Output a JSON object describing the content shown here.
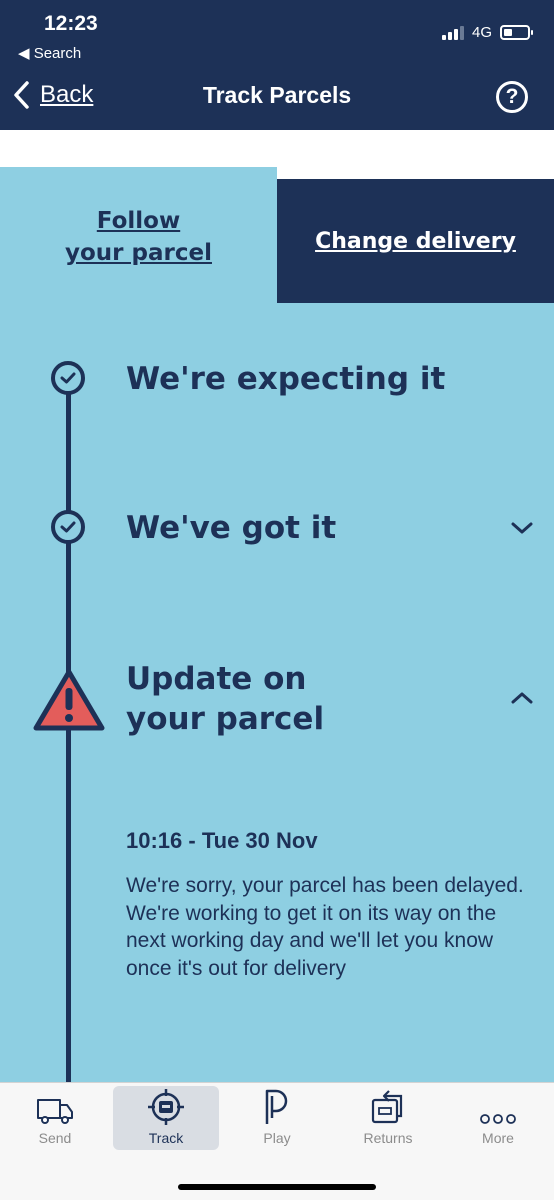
{
  "status_bar": {
    "time": "12:23",
    "back_app": "◀ Search",
    "network": "4G",
    "battery_level": 0.35
  },
  "header": {
    "back_label": "Back",
    "title": "Track Parcels",
    "help_icon": "question-circle-icon"
  },
  "tabs": {
    "follow_line1": "Follow",
    "follow_line2": "your parcel",
    "change": "Change delivery",
    "active": "follow"
  },
  "timeline": {
    "steps": [
      {
        "title": "We're expecting it",
        "status": "complete",
        "icon": "check-circle-icon"
      },
      {
        "title": "We've got it",
        "status": "complete",
        "icon": "check-circle-icon",
        "expander": "chevron-down-icon"
      },
      {
        "title_line1": "Update on",
        "title_line2": "your parcel",
        "status": "warning",
        "icon": "warning-triangle-icon",
        "expander": "chevron-up-icon"
      }
    ],
    "update": {
      "timestamp": "10:16 - Tue 30 Nov",
      "message": "We're sorry, your parcel has been delayed. We're working to get it on its way on the next working day and we'll let you know once it's out for delivery"
    }
  },
  "tabbar": {
    "items": [
      {
        "label": "Send",
        "icon": "van-icon"
      },
      {
        "label": "Track",
        "icon": "target-parcel-icon",
        "active": true
      },
      {
        "label": "Play",
        "icon": "play-p-icon"
      },
      {
        "label": "Returns",
        "icon": "returns-box-icon"
      },
      {
        "label": "More",
        "icon": "more-dots-icon"
      }
    ]
  },
  "colors": {
    "navy": "#1d3157",
    "sky": "#8ecfe2",
    "warning_red": "#e35d5b"
  }
}
